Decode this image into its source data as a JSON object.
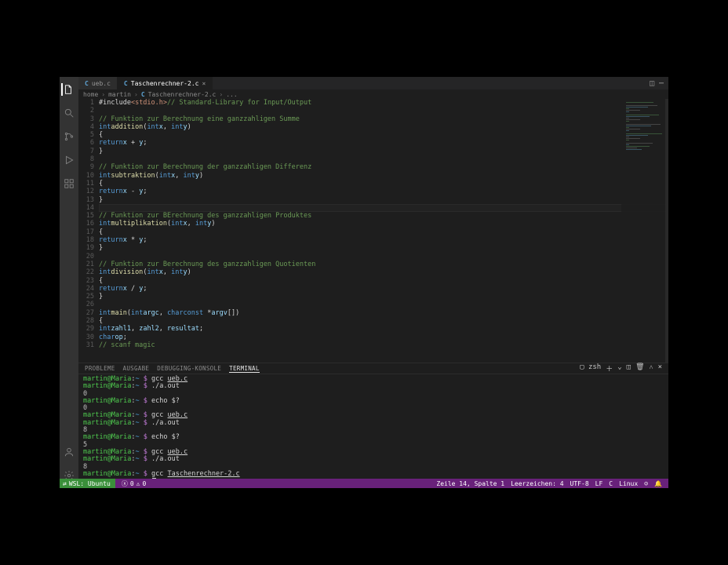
{
  "tabs": [
    {
      "icon": "C",
      "label": "ueb.c",
      "active": false,
      "closable": false
    },
    {
      "icon": "C",
      "label": "Taschenrechner-2.c",
      "active": true,
      "closable": true
    }
  ],
  "breadcrumbs": {
    "seg0": "home",
    "seg1": "martin",
    "icon": "C",
    "seg2": "Taschenrechner-2.c",
    "tail": "..."
  },
  "code": {
    "lines": [
      {
        "n": 1,
        "html": "<span class='tok-pun'>#include</span> <span class='tok-str'>&lt;stdio.h&gt;</span> <span class='tok-comment'>// Standard-Library for Input/Output</span>"
      },
      {
        "n": 2,
        "html": ""
      },
      {
        "n": 3,
        "html": "<span class='tok-comment'>// Funktion zur Berechnung eine ganzzahligen Summe</span>"
      },
      {
        "n": 4,
        "html": "<span class='tok-type'>int</span> <span class='tok-fn'>addition</span>(<span class='tok-type'>int</span> <span class='tok-var'>x</span>, <span class='tok-type'>int</span> <span class='tok-var'>y</span>)"
      },
      {
        "n": 5,
        "html": "{"
      },
      {
        "n": 6,
        "html": "    <span class='tok-kw'>return</span> <span class='tok-var'>x</span> + <span class='tok-var'>y</span>;"
      },
      {
        "n": 7,
        "html": "}"
      },
      {
        "n": 8,
        "html": ""
      },
      {
        "n": 9,
        "html": "<span class='tok-comment'>// Funktion zur Berechnung der ganzzahligen Differenz</span>"
      },
      {
        "n": 10,
        "html": "<span class='tok-type'>int</span> <span class='tok-fn'>subtraktion</span>(<span class='tok-type'>int</span> <span class='tok-var'>x</span>, <span class='tok-type'>int</span> <span class='tok-var'>y</span>)"
      },
      {
        "n": 11,
        "html": "{"
      },
      {
        "n": 12,
        "html": "    <span class='tok-kw'>return</span> <span class='tok-var'>x</span> - <span class='tok-var'>y</span>;"
      },
      {
        "n": 13,
        "html": "}"
      },
      {
        "n": 14,
        "html": "",
        "current": true
      },
      {
        "n": 15,
        "html": "<span class='tok-comment'>// Funktion zur BErechnung des ganzzahligen Produktes</span>"
      },
      {
        "n": 16,
        "html": "<span class='tok-type'>int</span> <span class='tok-fn'>multiplikation</span>(<span class='tok-type'>int</span> <span class='tok-var'>x</span>, <span class='tok-type'>int</span> <span class='tok-var'>y</span>)"
      },
      {
        "n": 17,
        "html": "{"
      },
      {
        "n": 18,
        "html": "    <span class='tok-kw'>return</span> <span class='tok-var'>x</span> * <span class='tok-var'>y</span>;"
      },
      {
        "n": 19,
        "html": "}"
      },
      {
        "n": 20,
        "html": ""
      },
      {
        "n": 21,
        "html": "<span class='tok-comment'>// Funktion zur Berechnung des ganzzahligen Quotienten</span>"
      },
      {
        "n": 22,
        "html": "<span class='tok-type'>int</span> <span class='tok-fn'>division</span>(<span class='tok-type'>int</span> <span class='tok-var'>x</span>, <span class='tok-type'>int</span> <span class='tok-var'>y</span>)"
      },
      {
        "n": 23,
        "html": "{"
      },
      {
        "n": 24,
        "html": "    <span class='tok-kw'>return</span> <span class='tok-var'>x</span> / <span class='tok-var'>y</span>;"
      },
      {
        "n": 25,
        "html": "}"
      },
      {
        "n": 26,
        "html": ""
      },
      {
        "n": 27,
        "html": "<span class='tok-type'>int</span> <span class='tok-fn'>main</span>(<span class='tok-type'>int</span> <span class='tok-var'>argc</span>, <span class='tok-type'>char</span> <span class='tok-kw'>const</span> *<span class='tok-var'>argv</span>[])"
      },
      {
        "n": 28,
        "html": "{"
      },
      {
        "n": 29,
        "html": "    <span class='tok-type'>int</span> <span class='tok-var'>zahl1</span>, <span class='tok-var'>zahl2</span>, <span class='tok-var'>resultat</span>;"
      },
      {
        "n": 30,
        "html": "    <span class='tok-type'>char</span> <span class='tok-var'>op</span>;"
      },
      {
        "n": 31,
        "html": "    <span class='tok-comment'>// scanf magic</span>"
      }
    ]
  },
  "panel": {
    "tabs": {
      "probleme": "PROBLEME",
      "ausgabe": "AUSGABE",
      "debug": "DEBUGGING-KONSOLE",
      "terminal": "TERMINAL"
    },
    "shell_label": "zsh"
  },
  "terminal": {
    "prompt_user": "martin@Maria",
    "prompt_path": "~",
    "prompt_sym": "$",
    "lines": [
      {
        "type": "prompt",
        "cmd": "gcc ",
        "file": "ueb.c"
      },
      {
        "type": "prompt",
        "cmd": "./a.out"
      },
      {
        "type": "out",
        "text": "0"
      },
      {
        "type": "prompt",
        "cmd": "echo $?"
      },
      {
        "type": "out",
        "text": "0"
      },
      {
        "type": "prompt",
        "cmd": "gcc ",
        "file": "ueb.c"
      },
      {
        "type": "prompt",
        "cmd": "./a.out"
      },
      {
        "type": "out",
        "text": "8"
      },
      {
        "type": "prompt",
        "cmd": "echo $?"
      },
      {
        "type": "out",
        "text": "5"
      },
      {
        "type": "prompt",
        "cmd": "gcc ",
        "file": "ueb.c"
      },
      {
        "type": "prompt",
        "cmd": "./a.out"
      },
      {
        "type": "out",
        "text": "8"
      },
      {
        "type": "prompt",
        "cmd": "gcc ",
        "file": "Taschenrechner-2.c"
      },
      {
        "type": "prompt",
        "cmd": "",
        "cursor": true
      }
    ]
  },
  "status": {
    "remote_label": "WSL: Ubuntu",
    "errors": "0",
    "warnings": "0",
    "cursor": "Zeile 14, Spalte 1",
    "spaces": "Leerzeichen: 4",
    "encoding": "UTF-8",
    "eol": "LF",
    "lang": "C",
    "os": "Linux"
  }
}
